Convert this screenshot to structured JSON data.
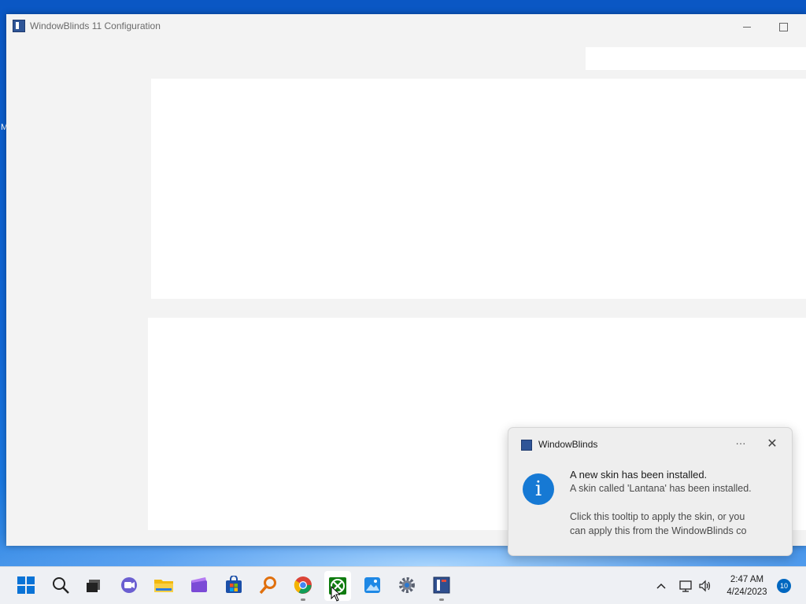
{
  "window": {
    "title": "WindowBlinds 11 Configuration"
  },
  "desktop": {
    "edge_text": "M"
  },
  "toast": {
    "app_name": "WindowBlinds",
    "more_label": "···",
    "close_label": "✕",
    "info_glyph": "i",
    "heading": "A new skin has been installed.",
    "line1": "A skin called 'Lantana' has been installed.",
    "line2": "Click this tooltip to apply the skin, or you",
    "line3": "can apply this from the WindowBlinds co"
  },
  "taskbar": {
    "apps": [
      {
        "name": "start-icon"
      },
      {
        "name": "search-icon"
      },
      {
        "name": "task-view-icon"
      },
      {
        "name": "teams-chat-icon"
      },
      {
        "name": "file-explorer-icon"
      },
      {
        "name": "clipchamp-icon"
      },
      {
        "name": "microsoft-store-icon"
      },
      {
        "name": "magnifier-app-icon"
      },
      {
        "name": "chrome-icon"
      },
      {
        "name": "xbox-icon"
      },
      {
        "name": "photos-icon"
      },
      {
        "name": "settings-icon"
      },
      {
        "name": "windowblinds-icon"
      }
    ],
    "clock": {
      "time": "2:47 AM",
      "date": "4/24/2023"
    },
    "notification_count": "10"
  }
}
